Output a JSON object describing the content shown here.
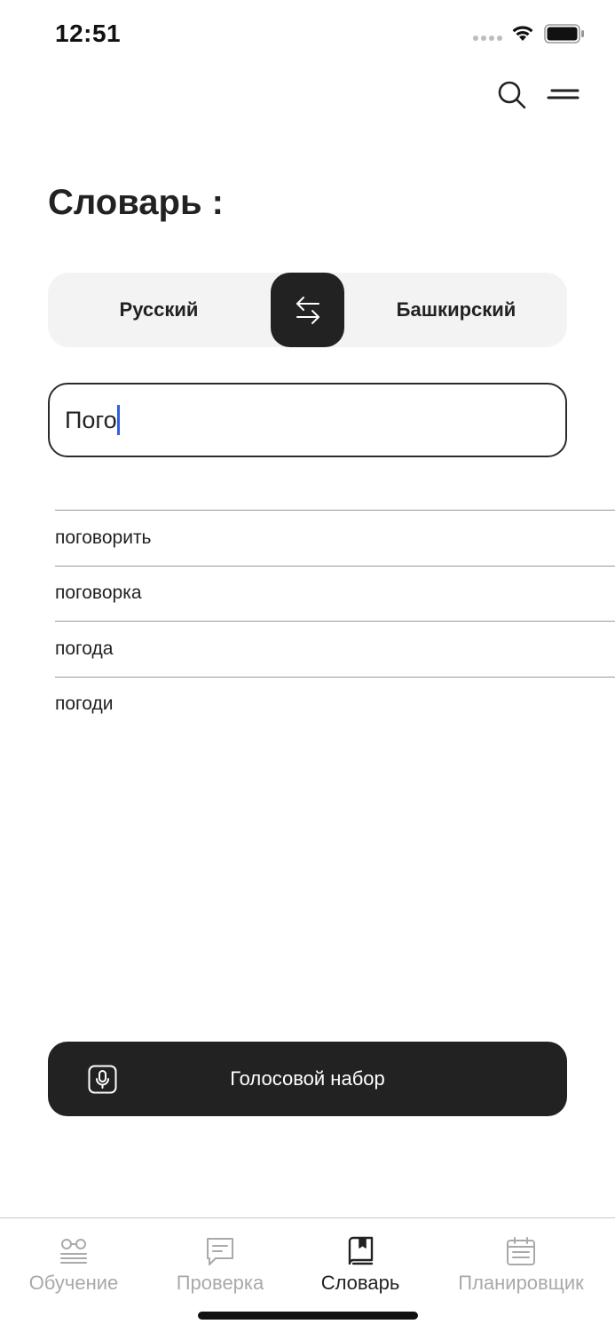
{
  "status_bar": {
    "time": "12:51"
  },
  "page": {
    "title": "Словарь :"
  },
  "language_switch": {
    "from": "Русский",
    "to": "Башкирский"
  },
  "search": {
    "value": "Пого"
  },
  "suggestions": [
    "поговорить",
    "поговорка",
    "погода",
    "погоди"
  ],
  "voice": {
    "label": "Голосовой набор"
  },
  "tabs": [
    {
      "label": "Обучение",
      "icon": "glasses-book-icon",
      "active": false
    },
    {
      "label": "Проверка",
      "icon": "chat-bubble-icon",
      "active": false
    },
    {
      "label": "Словарь",
      "icon": "bookmark-book-icon",
      "active": true
    },
    {
      "label": "Планировщик",
      "icon": "calendar-icon",
      "active": false
    }
  ],
  "colors": {
    "dark": "#222222",
    "muted": "#a9a9a9",
    "panel": "#f3f3f3",
    "caret": "#2f5fe0"
  }
}
